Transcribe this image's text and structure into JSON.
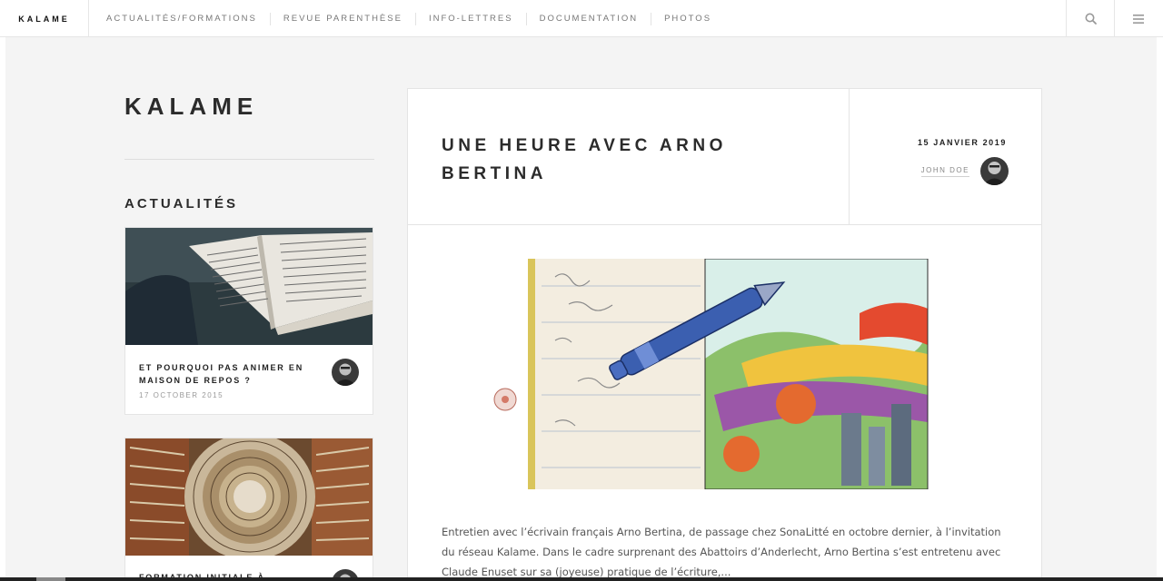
{
  "nav": {
    "brand": "KALAME",
    "items": [
      "ACTUALITÉS/FORMATIONS",
      "REVUE PARENTHÈSE",
      "INFO-LETTRES",
      "DOCUMENTATION",
      "PHOTOS"
    ],
    "search_icon": "search-icon",
    "menu_icon": "hamburger-menu-icon"
  },
  "sidebar": {
    "site_title": "KALAME",
    "section_heading": "ACTUALITÉS",
    "posts": [
      {
        "title": "ET POURQUOI PAS ANIMER EN MAISON DE REPOS ?",
        "date": "17 OCTOBER 2015",
        "image": "open-book-photo"
      },
      {
        "title": "FORMATION INITIALE À",
        "date": "",
        "image": "book-tower-photo"
      }
    ]
  },
  "article": {
    "title": "UNE HEURE AVEC ARNO BERTINA",
    "date": "15 JANVIER 2019",
    "author": "JOHN DOE",
    "image": "pen-landscape-drawing",
    "excerpt": "Entretien avec l’écrivain français Arno Bertina, de passage chez SonaLitté en octobre dernier, à l’invitation du réseau Kalame. Dans le cadre surprenant des Abattoirs d’Anderlecht, Arno Bertina s’est entretenu avec Claude Enuset sur sa (joyeuse) pratique de l’écriture,..."
  },
  "colors": {
    "page_background": "#f4f4f4",
    "card_background": "#ffffff",
    "title_text": "#2b2b2b",
    "muted_text": "#999999"
  }
}
